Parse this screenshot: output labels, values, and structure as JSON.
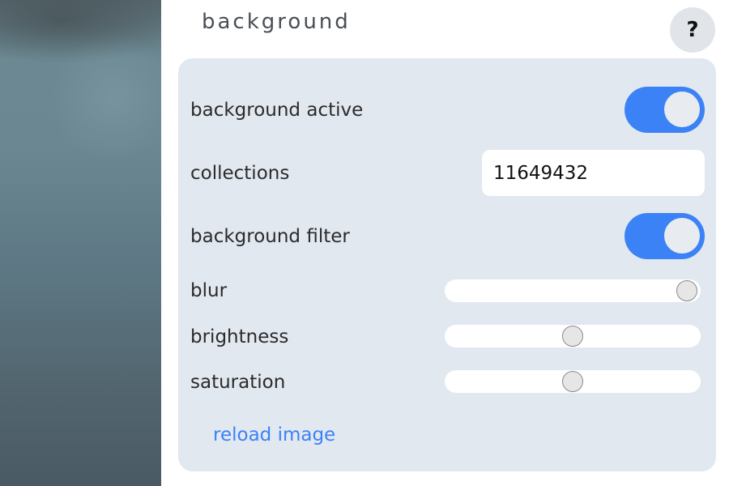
{
  "header": {
    "title": "background",
    "help_label": "?"
  },
  "settings": {
    "background_active": {
      "label": "background active",
      "enabled": true
    },
    "collections": {
      "label": "collections",
      "value": "11649432"
    },
    "background_filter": {
      "label": "background filter",
      "enabled": true
    },
    "blur": {
      "label": "blur",
      "level_fraction": 1.0
    },
    "brightness": {
      "label": "brightness",
      "level_fraction": 0.5
    },
    "saturation": {
      "label": "saturation",
      "level_fraction": 0.5
    }
  },
  "actions": {
    "reload_label": "reload image"
  },
  "colors": {
    "accent": "#3b82f6",
    "card": "#e2e8f0"
  }
}
